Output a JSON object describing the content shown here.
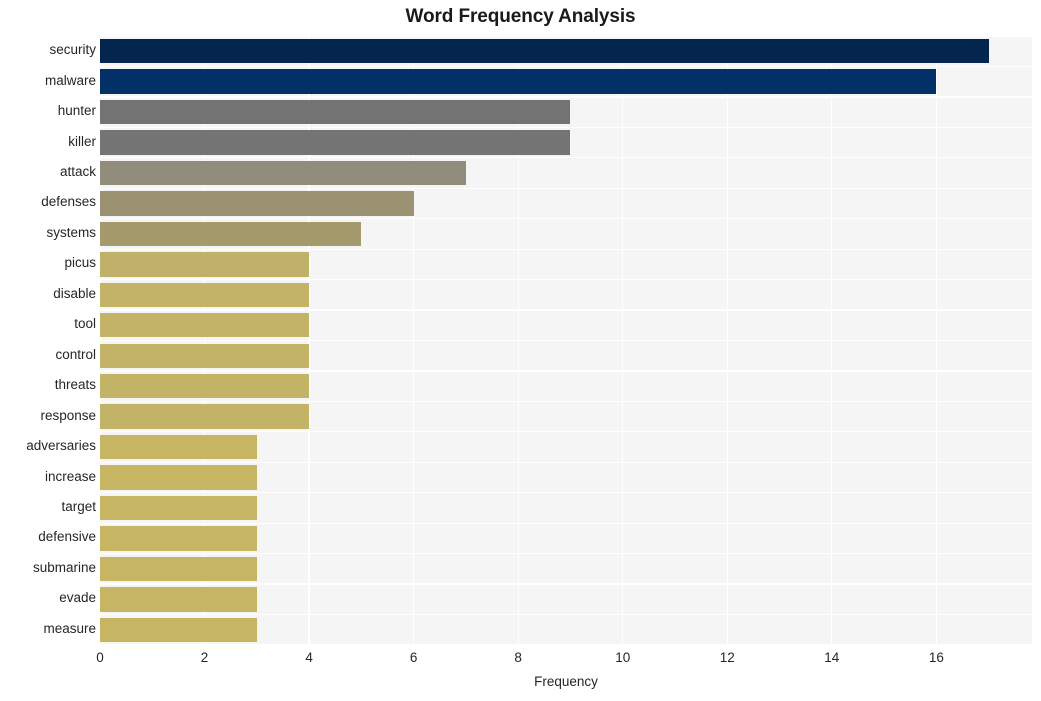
{
  "chart_data": {
    "type": "bar",
    "orientation": "horizontal",
    "title": "Word Frequency Analysis",
    "xlabel": "Frequency",
    "ylabel": "",
    "xlim": [
      0,
      17.83
    ],
    "grid": true,
    "legend": null,
    "xticks": [
      0,
      2,
      4,
      6,
      8,
      10,
      12,
      14,
      16
    ],
    "xtick_labels": [
      "0",
      "2",
      "4",
      "6",
      "8",
      "10",
      "12",
      "14",
      "16"
    ],
    "categories": [
      "security",
      "malware",
      "hunter",
      "killer",
      "attack",
      "defenses",
      "systems",
      "picus",
      "disable",
      "tool",
      "control",
      "threats",
      "response",
      "adversaries",
      "increase",
      "target",
      "defensive",
      "submarine",
      "evade",
      "measure"
    ],
    "values": [
      17,
      16,
      9,
      9,
      7,
      6,
      5,
      4,
      4,
      4,
      4,
      4,
      4,
      3,
      3,
      3,
      3,
      3,
      3,
      3
    ],
    "bar_colors": [
      "#04264e",
      "#033167",
      "#737373",
      "#747475",
      "#918c7c",
      "#9b9272",
      "#a49a6c",
      "#bfb169",
      "#c2b366",
      "#c2b366",
      "#c2b366",
      "#c2b366",
      "#c2b366",
      "#c6b663",
      "#c6b663",
      "#c6b663",
      "#c6b663",
      "#c6b663",
      "#c6b663",
      "#c6b663"
    ],
    "plot_background": "#f5f5f5",
    "gridline_color": "#ffffff",
    "figure_background": "#ffffff",
    "text_color": "#262626"
  }
}
